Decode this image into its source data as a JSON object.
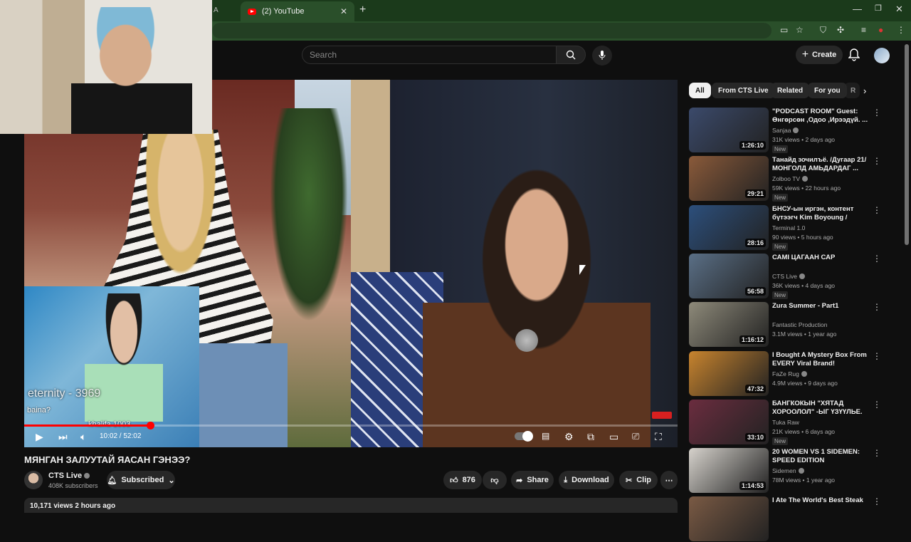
{
  "browser": {
    "tab_title": "(2) YouTube",
    "tab_close": "✕",
    "new_tab": "+",
    "prev_tab_fragment": "A",
    "window_minimize": "—",
    "window_maximize": "❐",
    "window_close": "✕"
  },
  "header": {
    "search_placeholder": "Search",
    "create_label": "Create"
  },
  "player": {
    "overlay_text": "eternity - 3969",
    "chat_line_1": "baina?",
    "chat_line_2": "khalifa 1003",
    "time_current": "10:02",
    "time_total": "52:02",
    "time_display": "10:02 / 52:02",
    "progress_fraction": 0.193
  },
  "video": {
    "title": "МЯНГАН ЗАЛУУТАЙ ЯАСАН ГЭНЭЭ?",
    "channel_name": "CTS Live",
    "channel_subscribers": "408K subscribers",
    "subscribed_label": "Subscribed",
    "like_count": "876",
    "share_label": "Share",
    "download_label": "Download",
    "clip_label": "Clip",
    "more_label": "⋯",
    "views_line": "10,171 views  2 hours ago"
  },
  "chips": [
    {
      "label": "All",
      "active": true
    },
    {
      "label": "From CTS Live",
      "active": false
    },
    {
      "label": "Related",
      "active": false
    },
    {
      "label": "For you",
      "active": false
    },
    {
      "label": "R",
      "active": false
    }
  ],
  "related": [
    {
      "title": "\"PODCAST ROOM\" Guest: Өнгөрсөн ,Одоо ,Ирээдүй. ...",
      "channel": "Sanjaa",
      "verified": true,
      "meta": "31K views • 2 days ago",
      "badge": "New",
      "duration": "1:26:10",
      "thumb": "#3b4a6b"
    },
    {
      "title": "Танайд зочилъё. /Дугаар 21/ МОНГОЛД АМЬДАРДАГ ...",
      "channel": "Zolboo TV",
      "verified": true,
      "meta": "59K views • 22 hours ago",
      "badge": "New",
      "duration": "29:21",
      "thumb": "#8a5a3a"
    },
    {
      "title": "БНСУ-ын иргэн, контент бүтээгч Kim Boyoung /Буяна...",
      "channel": "Terminal 1.0",
      "verified": false,
      "meta": "90 views • 5 hours ago",
      "badge": "New",
      "duration": "28:16",
      "thumb": "#2c4f7c"
    },
    {
      "title": "САМІ ЦАГААН САР",
      "channel": "CTS Live",
      "verified": true,
      "meta": "36K views • 4 days ago",
      "badge": "New",
      "duration": "56:58",
      "thumb": "#5a6f86"
    },
    {
      "title": "Zura Summer - Part1",
      "channel": "Fantastic Production",
      "verified": false,
      "meta": "3.1M views • 1 year ago",
      "badge": "",
      "duration": "1:16:12",
      "thumb": "#8e8a7a"
    },
    {
      "title": "I Bought A Mystery Box From EVERY Viral Brand!",
      "channel": "FaZe Rug",
      "verified": true,
      "meta": "4.9M views • 9 days ago",
      "badge": "",
      "duration": "47:32",
      "thumb": "#c8842e"
    },
    {
      "title": "БАНГКОКЫН \"ХЯТАД ХОРООЛОЛ\" -ЫГ ҮЗҮҮЛЬЕ. ...",
      "channel": "Tuka Raw",
      "verified": false,
      "meta": "21K views • 6 days ago",
      "badge": "New",
      "duration": "33:10",
      "thumb": "#6b2d3f"
    },
    {
      "title": "20 WOMEN VS 1 SIDEMEN: SPEED EDITION",
      "channel": "Sidemen",
      "verified": true,
      "meta": "78M views • 1 year ago",
      "badge": "",
      "duration": "1:14:53",
      "thumb": "#d6d2cc"
    },
    {
      "title": "I Ate The World's Best Steak",
      "channel": "",
      "verified": false,
      "meta": "",
      "badge": "",
      "duration": "",
      "thumb": "#7a5a44"
    }
  ]
}
